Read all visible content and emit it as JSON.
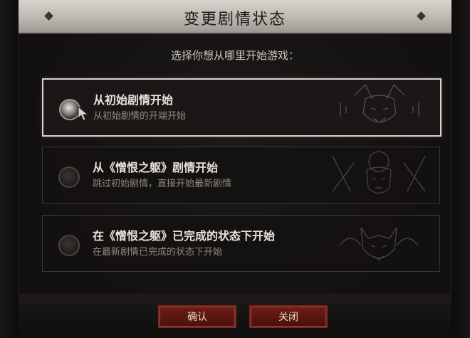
{
  "dialog": {
    "title": "变更剧情状态",
    "prompt": "选择你想从哪里开始游戏："
  },
  "options": [
    {
      "title": "从初始剧情开始",
      "desc": "从初始剧情的开端开始",
      "selected": true,
      "icon": "demon-head-icon"
    },
    {
      "title": "从《憎恨之躯》剧情开始",
      "desc": "跳过初始剧情，直接开始最新剧情",
      "selected": false,
      "icon": "masked-figure-icon"
    },
    {
      "title": "在《憎恨之躯》已完成的状态下开始",
      "desc": "在最新剧情已完成的状态下开始",
      "selected": false,
      "icon": "wolf-head-icon"
    }
  ],
  "buttons": {
    "confirm": "确认",
    "close": "关闭"
  },
  "colors": {
    "accent": "#6e1d17",
    "title_bg": "#c8c3bc",
    "text": "#e8e2da"
  }
}
